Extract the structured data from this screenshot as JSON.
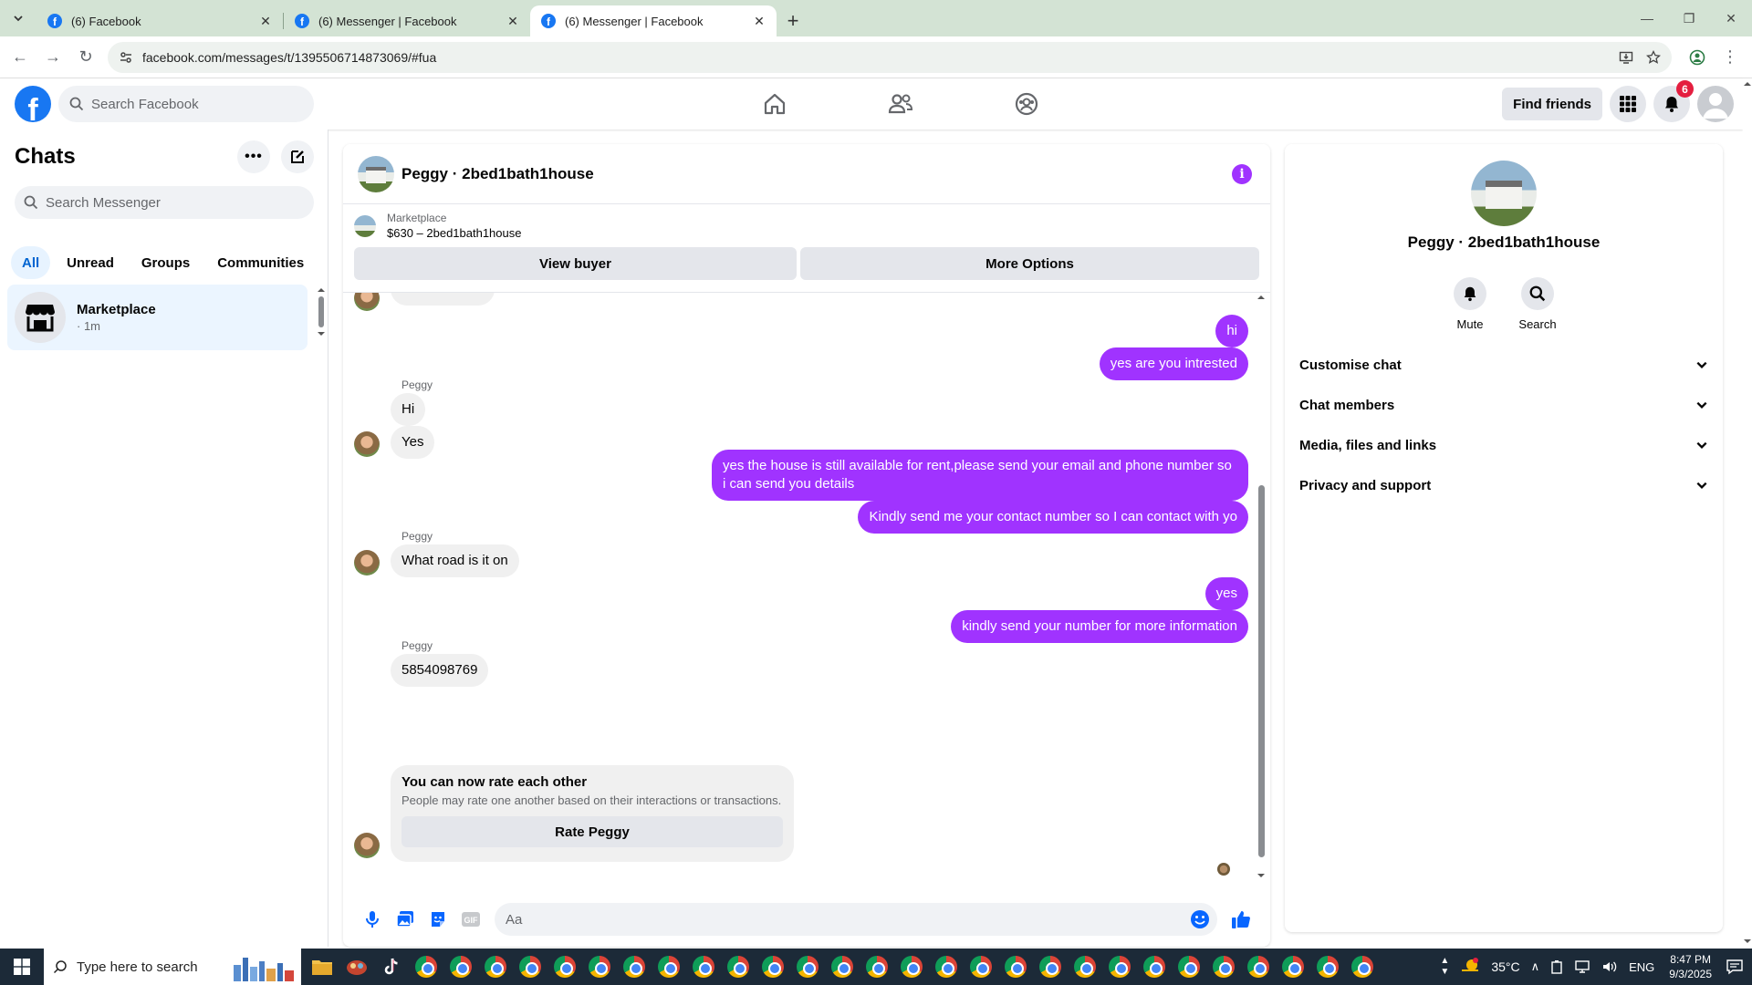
{
  "browser": {
    "tabs": [
      {
        "title": "(6) Facebook",
        "active": false
      },
      {
        "title": "(6) Messenger | Facebook",
        "active": false
      },
      {
        "title": "(6) Messenger | Facebook",
        "active": true
      }
    ],
    "url": "facebook.com/messages/t/1395506714873069/#fua"
  },
  "fb_header": {
    "search_placeholder": "Search Facebook",
    "find_friends": "Find friends",
    "notification_count": "6"
  },
  "sidebar": {
    "title": "Chats",
    "search_placeholder": "Search Messenger",
    "filters": [
      "All",
      "Unread",
      "Groups",
      "Communities"
    ],
    "active_filter": "All",
    "chats": [
      {
        "name": "Marketplace",
        "time": "· 1m"
      }
    ]
  },
  "conversation": {
    "title": "Peggy · 2bed1bath1house",
    "marketplace": {
      "label": "Marketplace",
      "listing": "$630 – 2bed1bath1house",
      "view_buyer": "View buyer",
      "more_options": "More Options"
    },
    "messages": [
      {
        "from": "me",
        "text": "hi"
      },
      {
        "from": "me",
        "text": "yes are you intrested"
      },
      {
        "from": "Peggy",
        "sender_label": "Peggy",
        "text": "Hi"
      },
      {
        "from": "Peggy",
        "text": "Yes"
      },
      {
        "from": "me",
        "text": "yes the house is still available for rent,please send your email and phone number so i can send you details"
      },
      {
        "from": "me",
        "text": "Kindly send me your contact number so I can contact with yo"
      },
      {
        "from": "Peggy",
        "sender_label": "Peggy",
        "text": "What road is it on"
      },
      {
        "from": "me",
        "text": "yes"
      },
      {
        "from": "me",
        "text": "kindly send your number for more information"
      },
      {
        "from": "Peggy",
        "sender_label": "Peggy",
        "text": "5854098769"
      }
    ],
    "rating": {
      "title": "You can now rate each other",
      "subtitle": "People may rate one another based on their interactions or transactions.",
      "button": "Rate Peggy"
    },
    "composer_placeholder": "Aa"
  },
  "details": {
    "name": "Peggy · 2bed1bath1house",
    "actions": [
      "Mute",
      "Search"
    ],
    "sections": [
      "Customise chat",
      "Chat members",
      "Media, files and links",
      "Privacy and support"
    ]
  },
  "taskbar": {
    "search_placeholder": "Type here to search",
    "temperature": "35°C",
    "language": "ENG",
    "time": "8:47 PM",
    "date": "9/3/2025"
  },
  "colors": {
    "accent_purple": "#a033ff",
    "fb_blue": "#1877f2",
    "badge_red": "#e41e3f"
  }
}
